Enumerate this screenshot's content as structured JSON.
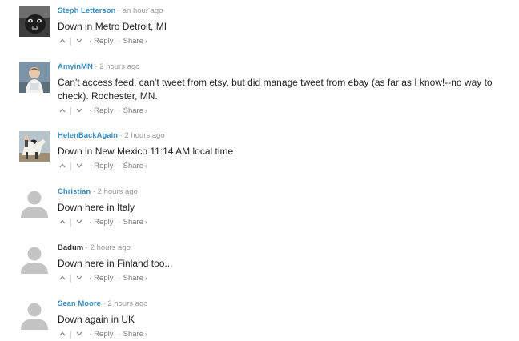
{
  "comments": [
    {
      "author": "Steph Letterson",
      "time": "an hour ago",
      "text": "Down in Metro Detroit, MI",
      "avatar": "dog-photo"
    },
    {
      "author": "AmyinMN",
      "time": "2 hours ago",
      "text": "Can't access feed, can't tweet from etsy, but did manage tweet from ebay (as far as I know!--no way to check). Rochester, MN.",
      "avatar": "child-photo"
    },
    {
      "author": "HelenBackAgain",
      "time": "2 hours ago",
      "text": "Down in New Mexico 11:14 AM local time",
      "avatar": "horse-photo"
    },
    {
      "author": "Christian",
      "time": "2 hours ago",
      "text": "Down here in Italy",
      "avatar": "default-avatar"
    },
    {
      "author": "Badum",
      "time": "2 hours ago",
      "text": "Down here in Finland too...",
      "avatar": "default-avatar"
    },
    {
      "author": "Sean Moore",
      "time": "2 hours ago",
      "text": "Down again in UK",
      "avatar": "default-avatar"
    }
  ],
  "labels": {
    "reply": "Reply",
    "share": "Share",
    "meta_separator": "·",
    "action_separator": "·",
    "share_arrow": "›"
  },
  "colors": {
    "author_link": "#3b8ec2",
    "author_plain": "#3a3a3a",
    "meta": "#999999",
    "text": "#222222",
    "actions": "#7a7a7a",
    "avatar_placeholder": "#c4c4c4"
  }
}
